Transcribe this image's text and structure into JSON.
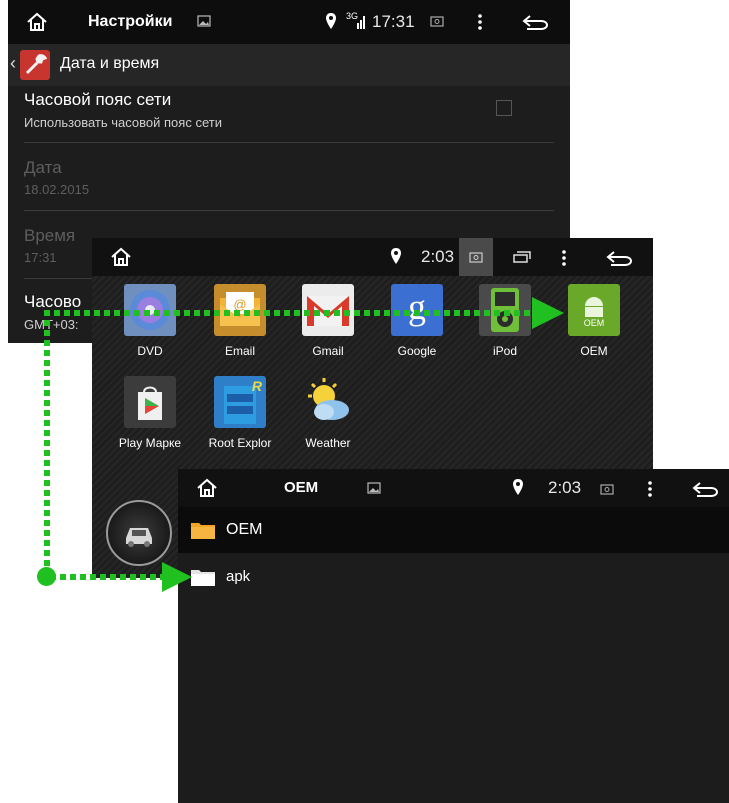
{
  "settings": {
    "status": {
      "title": "Настройки",
      "signal": "3G",
      "time": "17:31"
    },
    "header": {
      "title": "Дата и время"
    },
    "rows": [
      {
        "title": "Часовой пояс сети",
        "subtitle": "Использовать часовой пояс сети",
        "checked": false
      },
      {
        "title": "Дата",
        "subtitle": "18.02.2015",
        "disabled": true
      },
      {
        "title": "Время",
        "subtitle": "17:31",
        "disabled": true
      },
      {
        "title": "Часово",
        "subtitle": "GMT+03:"
      }
    ]
  },
  "launcher": {
    "status": {
      "time": "2:03"
    },
    "apps": [
      {
        "label": "DVD",
        "icon": "dvd-icon"
      },
      {
        "label": "Email",
        "icon": "email-icon"
      },
      {
        "label": "Gmail",
        "icon": "gmail-icon"
      },
      {
        "label": "Google",
        "icon": "google-icon"
      },
      {
        "label": "iPod",
        "icon": "ipod-icon"
      },
      {
        "label": "OEM",
        "icon": "oem-android-icon"
      },
      {
        "label": "Play Марке",
        "icon": "play-store-icon"
      },
      {
        "label": "Root Explor",
        "icon": "root-explorer-icon"
      },
      {
        "label": "Weather",
        "icon": "weather-icon"
      }
    ],
    "google_glyph": "g",
    "oem_badge": "OEM",
    "root_badge": "R"
  },
  "filemanager": {
    "status": {
      "title": "OEM",
      "time": "2:03"
    },
    "items": [
      {
        "label": "OEM",
        "selected": true,
        "icon": "folder-icon"
      },
      {
        "label": "apk",
        "selected": false,
        "icon": "folder-icon"
      }
    ]
  },
  "colors": {
    "arrow": "#21c021",
    "folder_orange": "#f3a52a",
    "status_bar": "#0d0d0d",
    "panel": "#1c1c1c"
  }
}
